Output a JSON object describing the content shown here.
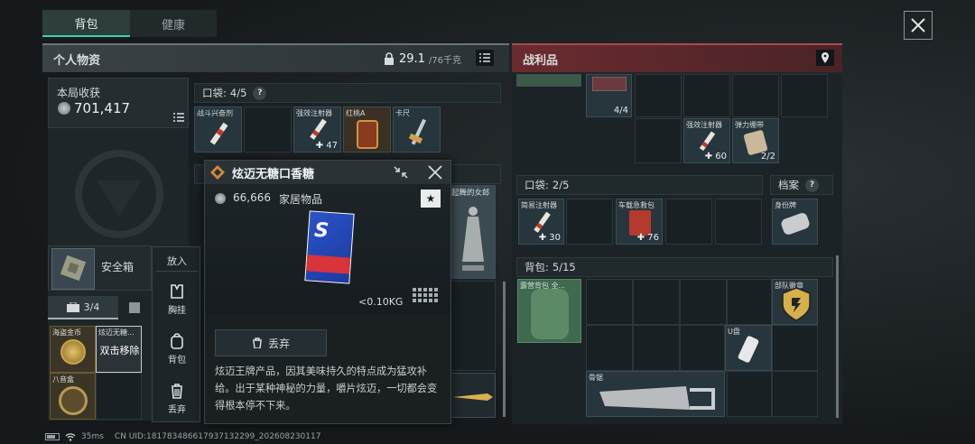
{
  "tabs": [
    {
      "label": "背包"
    },
    {
      "label": "健康"
    }
  ],
  "personal": {
    "title": "个人物资",
    "weight_value": "29.1",
    "weight_max": "/76千克",
    "earnings_label": "本局收获",
    "earnings_value": "701,417",
    "pocket_label": "口袋:",
    "pocket_count": "4/5",
    "pocket_items": [
      {
        "name": "战斗兴奋剂",
        "qty": ""
      },
      {
        "name": "",
        "qty": ""
      },
      {
        "name": "强效注射器",
        "qty": "47"
      },
      {
        "name": "红桃A",
        "qty": ""
      },
      {
        "name": "卡尺",
        "qty": ""
      }
    ],
    "safebox_label": "安全箱",
    "container_tab": "3/4",
    "container_items": [
      {
        "name": "海盗金币"
      },
      {
        "name": "炫迈无糖..."
      },
      {
        "name": "八音盒"
      }
    ],
    "double_click_remove": "双击移除",
    "behind_label": "起舞的女郎"
  },
  "loot": {
    "title": "战利品",
    "top_items": [
      {
        "name": "",
        "qty": "4/4"
      },
      {
        "name": "强效注射器",
        "qty": "60"
      },
      {
        "name": "弹力绷带",
        "qty": "2/2"
      }
    ],
    "pocket_label": "口袋:",
    "pocket_count": "2/5",
    "archive_label": "档案",
    "pocket_items": [
      {
        "name": "简易注射器",
        "qty": "30"
      },
      {
        "name": "车载急救包",
        "qty": "76"
      }
    ],
    "archive_item": {
      "name": "身份牌"
    },
    "backpack_label": "背包:",
    "backpack_count": "5/15",
    "backpack_items": [
      {
        "name": "露营背包\n全..."
      },
      {
        "name": "部队徽章"
      },
      {
        "name": "U盘"
      },
      {
        "name": "骨锯"
      }
    ]
  },
  "context_menu": {
    "title": "放入",
    "items": [
      {
        "label": "胸挂",
        "icon": "vest-icon"
      },
      {
        "label": "背包",
        "icon": "backpack-icon"
      },
      {
        "label": "丢弃",
        "icon": "trash-icon"
      }
    ]
  },
  "popup": {
    "title": "炫迈无糖口香糖",
    "value": "66,666",
    "category": "家居物品",
    "weight": "<0.10KG",
    "discard_label": "丢弃",
    "description": "炫迈王牌产品，因其美味持久的特点成为猛攻补给。出于某种神秘的力量，嚼片炫迈，一切都会变得根本停不下来。"
  },
  "status": {
    "ping": "35ms",
    "uid": "CN UID:18178348661793713229​9_202608230117"
  },
  "colors": {
    "accent_green": "#35d3a6",
    "loot_red": "#7a2a2f",
    "backpack_green": "#4b7a5a"
  }
}
